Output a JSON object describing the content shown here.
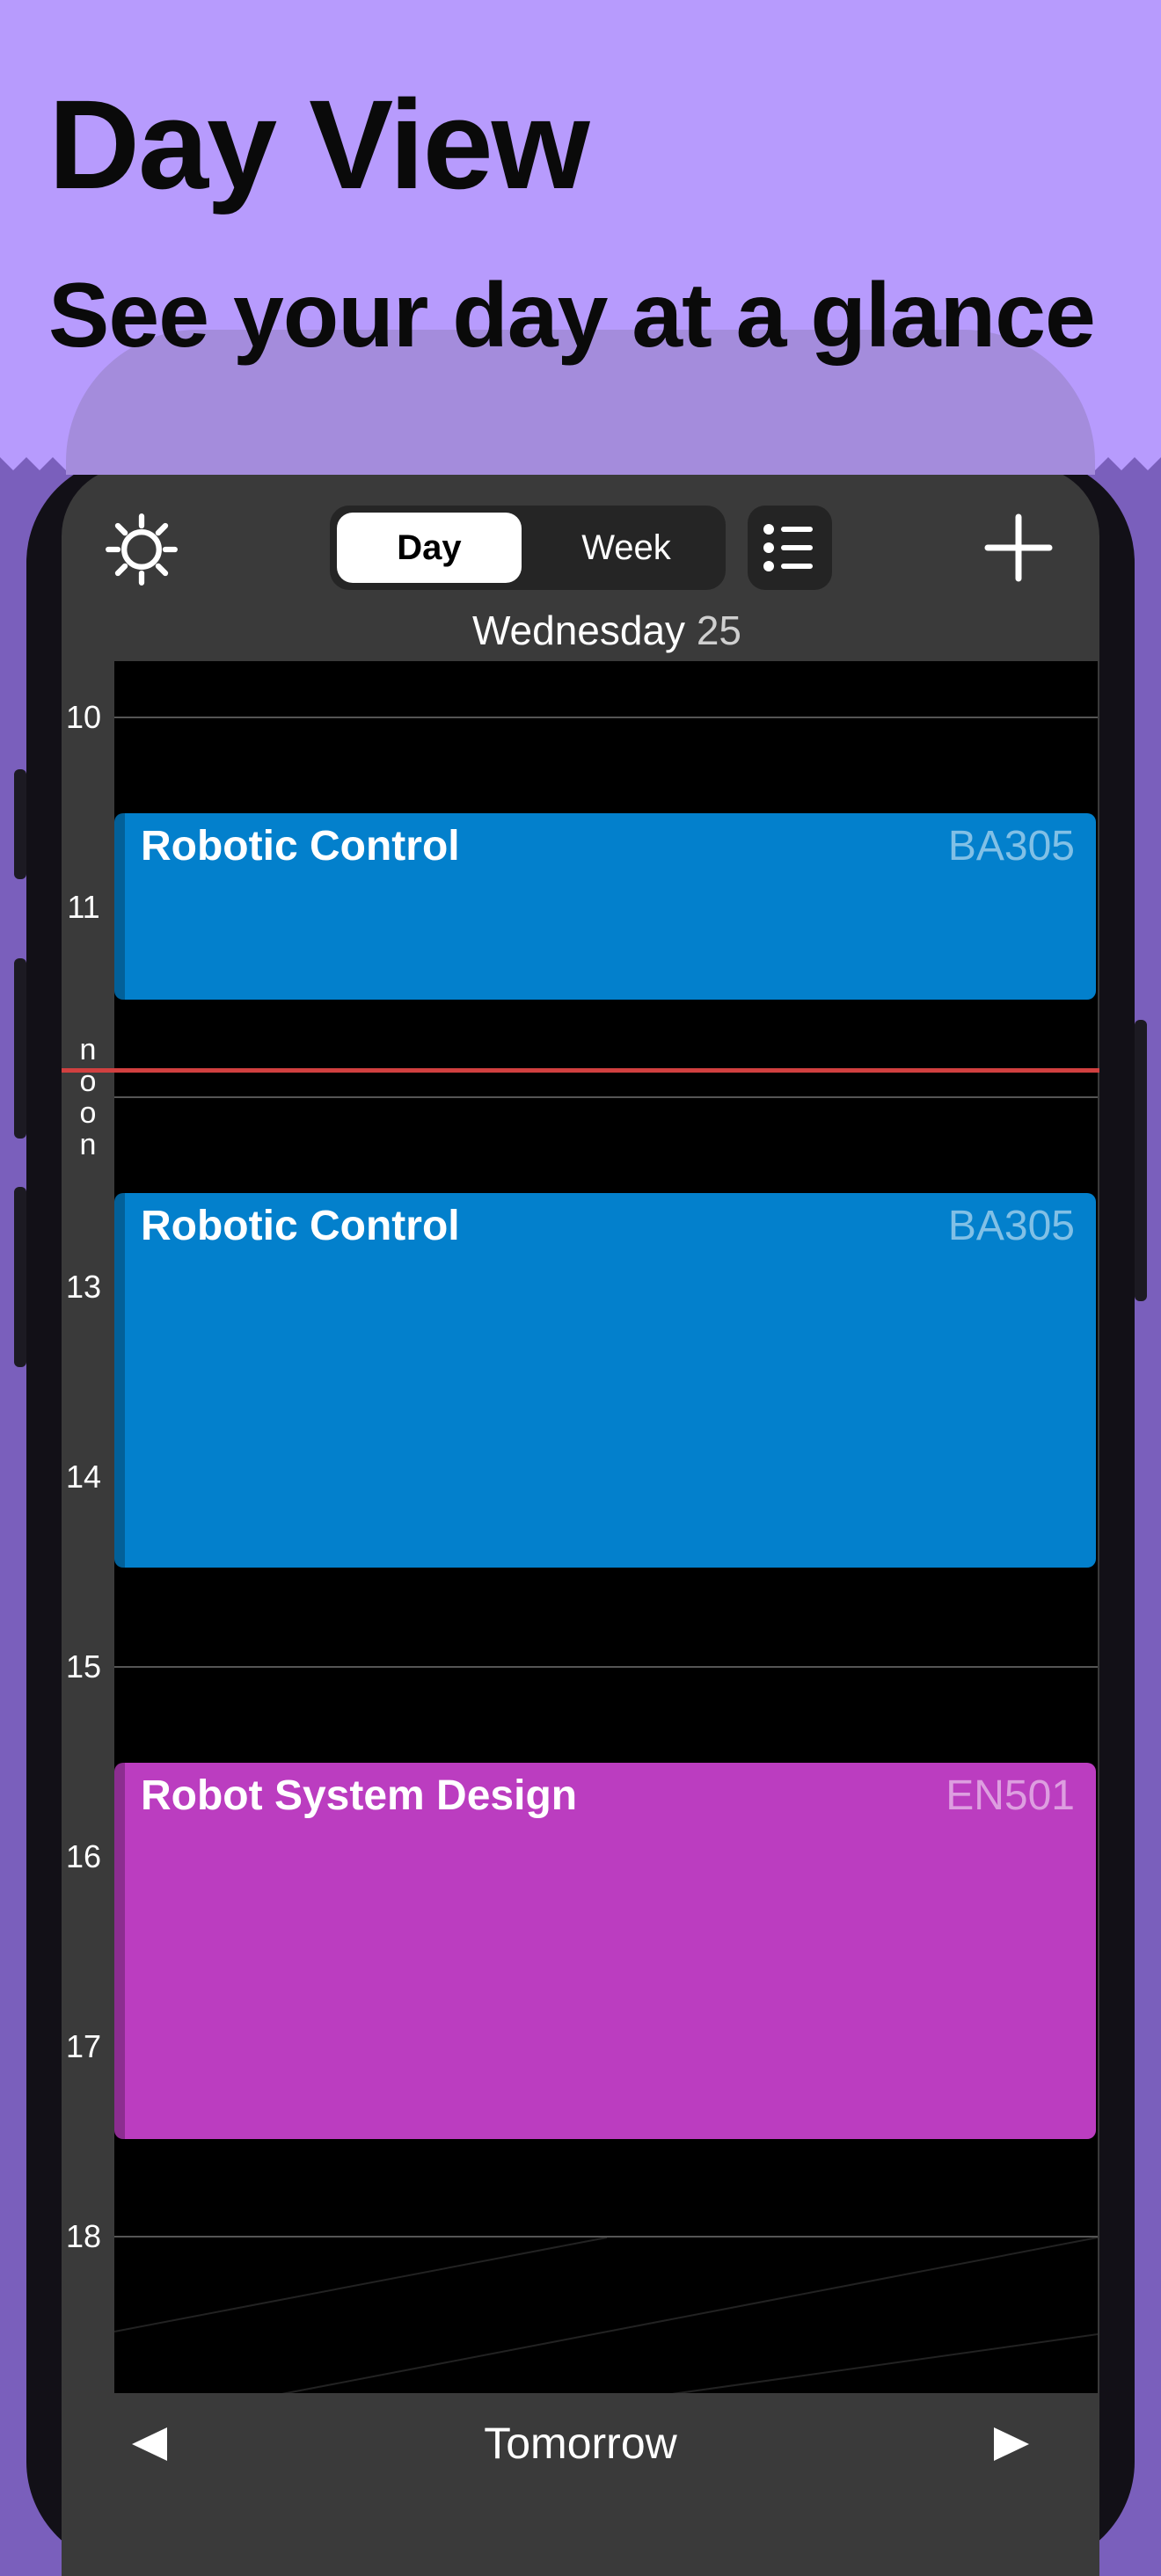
{
  "banner": {
    "title": "Day View",
    "subtitle": "See your day at a glance",
    "background": "#b79bfd"
  },
  "toolbar": {
    "settings_icon": "gear-icon",
    "segments": [
      {
        "label": "Day",
        "selected": true
      },
      {
        "label": "Week",
        "selected": false
      }
    ],
    "list_icon": "list-icon",
    "add_icon": "plus-icon"
  },
  "date": {
    "weekday": "Wednesday",
    "day": "25"
  },
  "hours": [
    "10",
    "11",
    "noon",
    "13",
    "14",
    "15",
    "16",
    "17",
    "18"
  ],
  "events": [
    {
      "title": "Robotic Control",
      "room": "BA305",
      "color": "#0380cc"
    },
    {
      "title": "Robotic Control",
      "room": "BA305",
      "color": "#0380cc"
    },
    {
      "title": "Robot System Design",
      "room": "EN501",
      "color": "#bb3dc0"
    }
  ],
  "bottom_bar": {
    "prev_icon": "triangle-left-icon",
    "label": "Tomorrow",
    "next_icon": "triangle-right-icon"
  },
  "colors": {
    "now_line": "#d14040",
    "timeline_bg": "#000000",
    "chrome_bg": "#3a3a3a"
  }
}
